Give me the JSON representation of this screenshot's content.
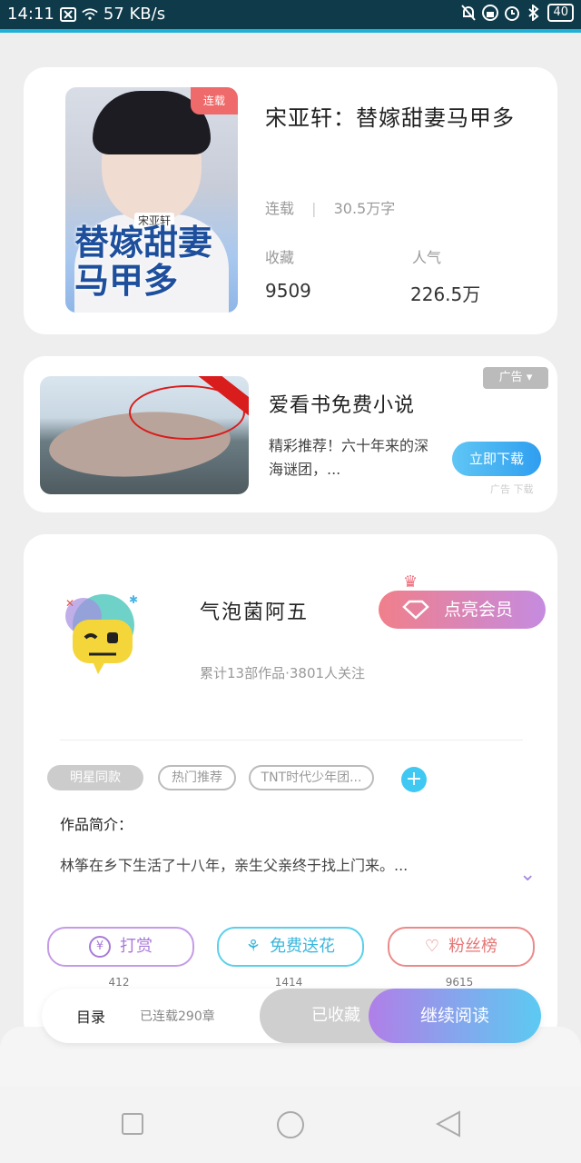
{
  "status_bar": {
    "time": "14:11",
    "speed": "57 KB/s",
    "battery": "40"
  },
  "book": {
    "cover_tag": "连载",
    "cover_title": "替嫁甜妻马甲多",
    "cover_author": "宋亚轩",
    "title": "宋亚轩：替嫁甜妻马甲多",
    "status": "连载",
    "word_count": "30.5万字",
    "fav_label": "收藏",
    "fav_value": "9509",
    "pop_label": "人气",
    "pop_value": "226.5万"
  },
  "ad": {
    "tag": "广告",
    "title": "爱看书免费小说",
    "description": "精彩推荐！六十年来的深海谜团，...",
    "button": "立即下载",
    "note": "广告 下载"
  },
  "author": {
    "name": "气泡菌阿五",
    "meta": "累计13部作品·3801人关注",
    "vip_button": "点亮会员",
    "chips": [
      "明星同款",
      "热门推荐",
      "TNT时代少年团..."
    ],
    "add_chip": "+",
    "works_label": "作品简介：",
    "intro": "林筝在乡下生活了十八年，亲生父亲终于找上门来。..."
  },
  "actions": [
    {
      "label": "打赏",
      "value": "412"
    },
    {
      "label": "免费送花",
      "value": "1414"
    },
    {
      "label": "粉丝榜",
      "value": "9615"
    }
  ],
  "read_bar": {
    "directory": "目录",
    "updated": "已连载290章",
    "favorited": "已收藏",
    "continue": "继续阅读"
  },
  "colors": {
    "accent": "#1fb0d6",
    "vip_start": "#f07f8b",
    "vip_end": "#c58be0",
    "read_start": "#b07fe8",
    "read_end": "#5ccaf2"
  }
}
